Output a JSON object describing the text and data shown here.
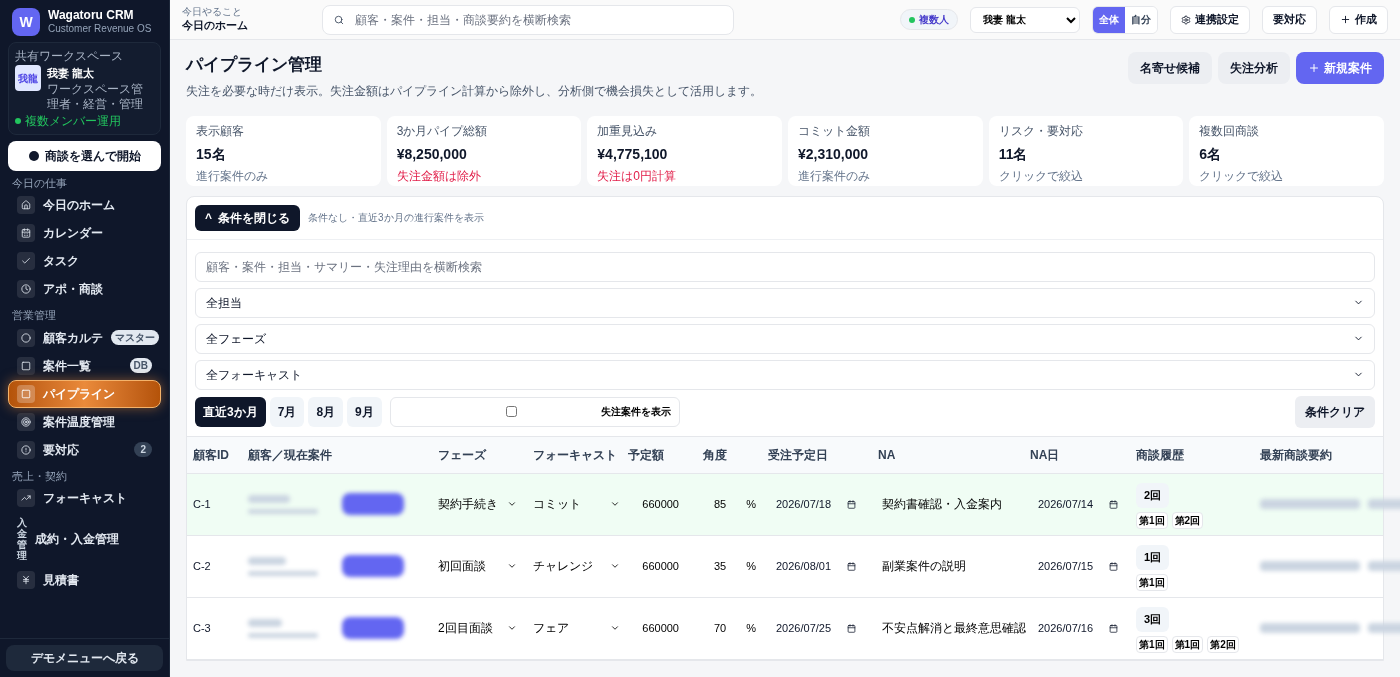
{
  "sidebar": {
    "brand": {
      "logo": "W",
      "name": "Wagatoru CRM",
      "tagline": "Customer Revenue OS"
    },
    "workspace": {
      "label": "共有ワークスペース",
      "avatar": "我龍",
      "user": "我妻 龍太",
      "role": "ワークスペース管理者・経営・管理",
      "status": "複数メンバー運用"
    },
    "start_button": "商談を選んで開始",
    "sections": [
      {
        "title": "今日の仕事",
        "items": [
          {
            "label": "今日のホーム",
            "selected": false
          },
          {
            "label": "カレンダー",
            "selected": false
          },
          {
            "label": "タスク",
            "selected": false
          },
          {
            "label": "アポ・商談",
            "selected": false
          }
        ]
      },
      {
        "title": "営業管理",
        "items": [
          {
            "label": "顧客カルテ",
            "selected": false,
            "badge": "マスター"
          },
          {
            "label": "案件一覧",
            "selected": false,
            "badge": "DB"
          },
          {
            "label": "パイプライン",
            "selected": true
          },
          {
            "label": "案件温度管理",
            "selected": false
          },
          {
            "label": "要対応",
            "selected": false,
            "count": "2"
          }
        ]
      },
      {
        "title": "売上・契約",
        "items": [
          {
            "label": "フォーキャスト",
            "selected": false
          },
          {
            "label": "成約・入金管理",
            "icon_text": "入金管理",
            "selected": false
          },
          {
            "label": "見積書",
            "selected": false
          }
        ]
      }
    ],
    "footer_button": "デモメニューへ戻る"
  },
  "topbar": {
    "eyebrow": "今日やること",
    "title": "今日のホーム",
    "search_placeholder": "顧客・案件・担当・商談要約を横断検索",
    "mode_badge": "複数人",
    "user_select": "我妻 龍太",
    "scope": [
      {
        "label": "全体",
        "selected": true
      },
      {
        "label": "自分",
        "selected": false
      }
    ],
    "buttons": [
      "連携設定",
      "要対応",
      "作成"
    ]
  },
  "page": {
    "title": "パイプライン管理",
    "subtitle": "失注を必要な時だけ表示。失注金額はパイプライン計算から除外し、分析側で機会損失として活用します。",
    "actions": [
      {
        "label": "名寄せ候補",
        "primary": false
      },
      {
        "label": "失注分析",
        "primary": false
      },
      {
        "label": "新規案件",
        "primary": true
      }
    ]
  },
  "stats": [
    {
      "label": "表示顧客",
      "value": "15名",
      "note": "進行案件のみ",
      "alert": false
    },
    {
      "label": "3か月パイプ総額",
      "value": "¥8,250,000",
      "note": "失注金額は除外",
      "alert": true
    },
    {
      "label": "加重見込み",
      "value": "¥4,775,100",
      "note": "失注は0円計算",
      "alert": true
    },
    {
      "label": "コミット金額",
      "value": "¥2,310,000",
      "note": "進行案件のみ",
      "alert": false
    },
    {
      "label": "リスク・要対応",
      "value": "11名",
      "note": "クリックで絞込",
      "alert": false
    },
    {
      "label": "複数回商談",
      "value": "6名",
      "note": "クリックで絞込",
      "alert": false
    }
  ],
  "filters": {
    "toggle_button": "条件を閉じる",
    "toggle_icon": "^",
    "summary": "条件なし・直近3か月の進行案件を表示",
    "search_placeholder": "顧客・案件・担当・サマリー・失注理由を横断検索",
    "selects": [
      "全担当",
      "全フェーズ",
      "全フォーキャスト"
    ],
    "periods": [
      {
        "label": "直近3か月",
        "selected": true
      },
      {
        "label": "7月",
        "selected": false
      },
      {
        "label": "8月",
        "selected": false
      },
      {
        "label": "9月",
        "selected": false
      }
    ],
    "show_lost": {
      "label": "失注案件を表示",
      "checked": false
    },
    "clear_button": "条件クリア"
  },
  "table": {
    "columns": [
      "顧客ID",
      "顧客／現在案件",
      "フェーズ",
      "フォーキャスト",
      "予定額",
      "角度",
      "受注予定日",
      "NA",
      "NA日",
      "商談履歴",
      "最新商談要約"
    ],
    "rows": [
      {
        "id": "C-1",
        "selected": true,
        "phase": "契約手続き",
        "forecast": "コミット",
        "amount": "660000",
        "probability": "85",
        "unit": "%",
        "close_date": "2026/07/18",
        "next_action": "契約書確認・入金案内",
        "na_date": "2026/07/14",
        "meetings": "2回",
        "history": [
          "第1回",
          "第2回"
        ]
      },
      {
        "id": "C-2",
        "selected": false,
        "phase": "初回面談",
        "forecast": "チャレンジ",
        "amount": "660000",
        "probability": "35",
        "unit": "%",
        "close_date": "2026/08/01",
        "next_action": "副業案件の説明",
        "na_date": "2026/07/15",
        "meetings": "1回",
        "history": [
          "第1回"
        ]
      },
      {
        "id": "C-3",
        "selected": false,
        "phase": "2回目面談",
        "forecast": "フェア",
        "amount": "660000",
        "probability": "70",
        "unit": "%",
        "close_date": "2026/07/25",
        "next_action": "不安点解消と最終意思確認",
        "na_date": "2026/07/16",
        "meetings": "3回",
        "history": [
          "第1回",
          "第1回",
          "第2回"
        ]
      }
    ]
  }
}
